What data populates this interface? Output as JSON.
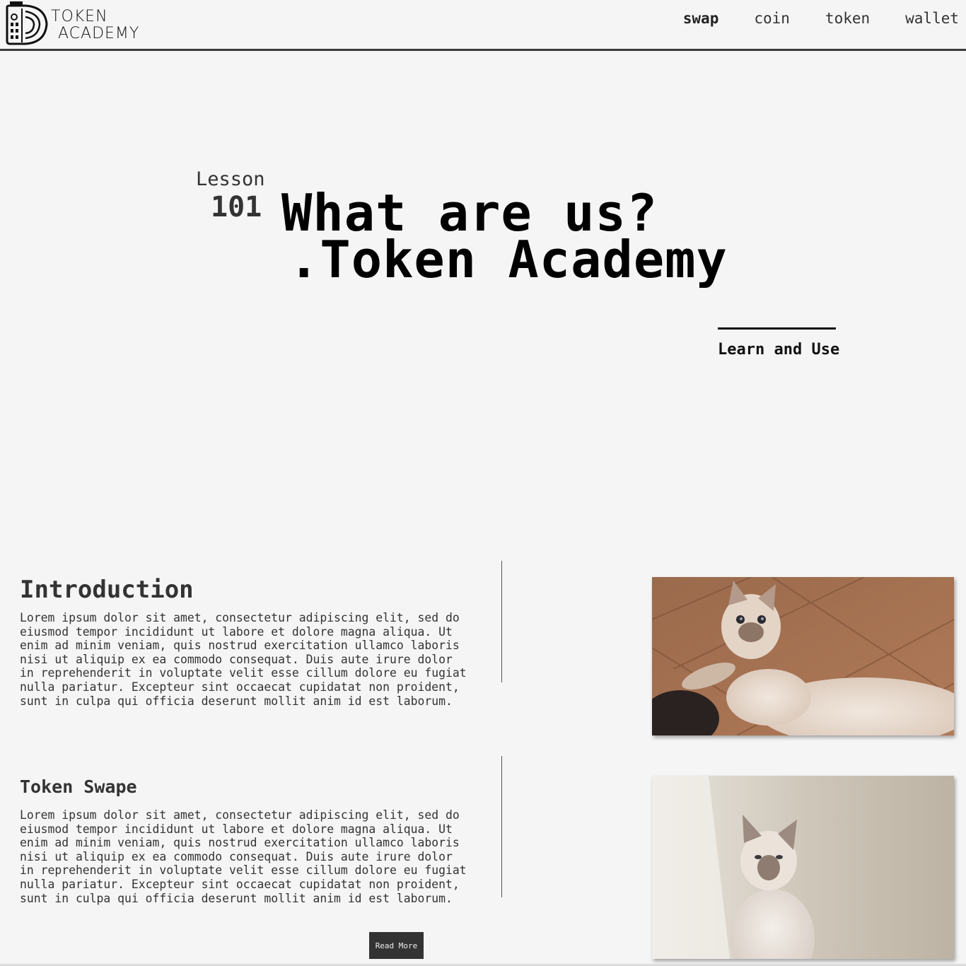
{
  "header": {
    "logo_line1": "TOKEN",
    "logo_line2": "ACADEMY",
    "nav": [
      {
        "label": "swap",
        "active": true
      },
      {
        "label": "coin",
        "active": false
      },
      {
        "label": "token",
        "active": false
      },
      {
        "label": "wallet",
        "active": false
      }
    ]
  },
  "hero": {
    "lesson_label": "Lesson",
    "lesson_number": "101",
    "title_line1": "What are us?",
    "title_line2": ".Token Academy",
    "cta": "Learn and Use"
  },
  "sections": [
    {
      "title": "Introduction",
      "body": "Lorem ipsum dolor sit amet, consectetur adipiscing elit, sed do eiusmod tempor incididunt ut labore et dolore magna aliqua. Ut enim ad minim veniam, quis nostrud exercitation ullamco laboris nisi ut aliquip ex ea commodo consequat. Duis aute irure dolor in reprehenderit in voluptate velit esse cillum dolore eu fugiat nulla pariatur. Excepteur sint occaecat cupidatat non proident, sunt in culpa qui officia deserunt mollit anim id est laborum."
    },
    {
      "title": "Token Swape",
      "body": "Lorem ipsum dolor sit amet, consectetur adipiscing elit, sed do eiusmod tempor incididunt ut labore et dolore magna aliqua. Ut enim ad minim veniam, quis nostrud exercitation ullamco laboris nisi ut aliquip ex ea commodo consequat. Duis aute irure dolor in reprehenderit in voluptate velit esse cillum dolore eu fugiat nulla pariatur. Excepteur sint occaecat cupidatat non proident, sunt in culpa qui officia deserunt mollit anim id est laborum."
    }
  ],
  "read_more": "Read More",
  "colors": {
    "background": "#f5f5f5",
    "text": "#111111",
    "button_bg": "#333333"
  }
}
